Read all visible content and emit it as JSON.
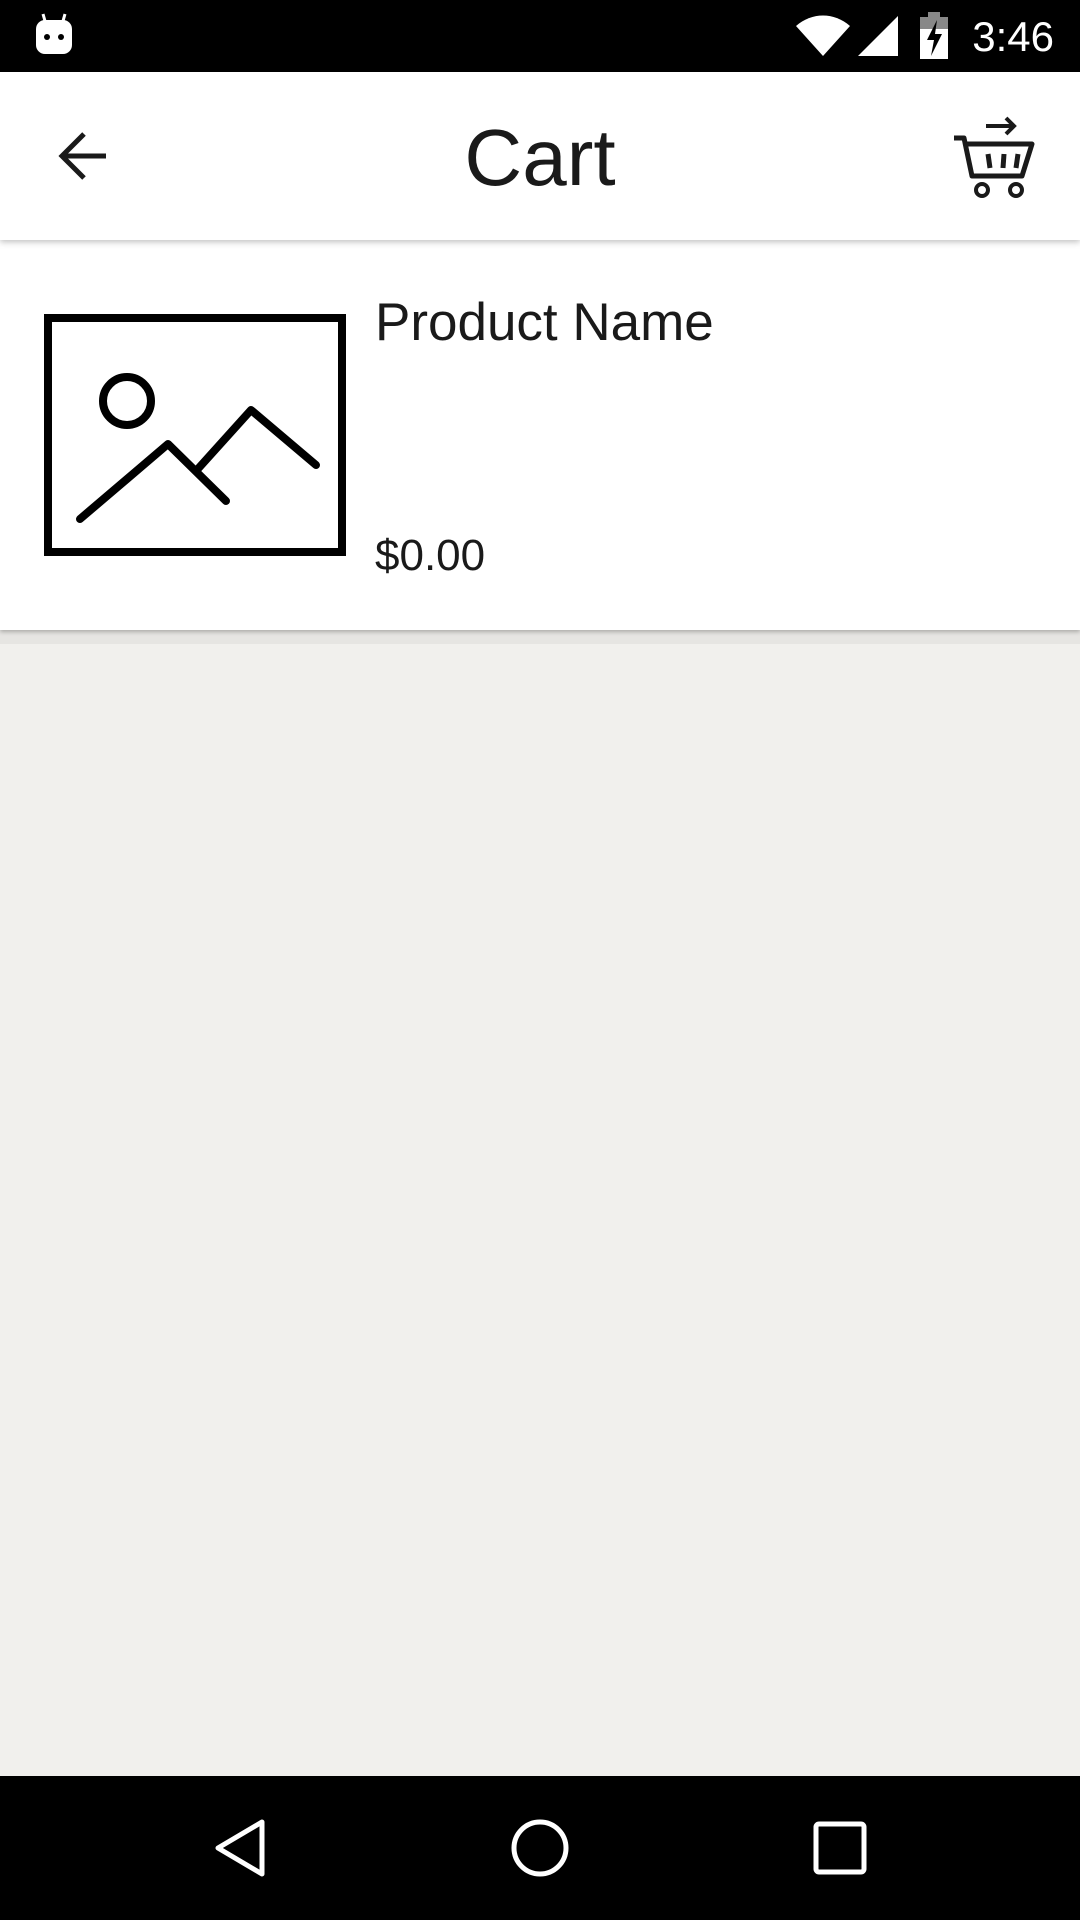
{
  "status_bar": {
    "time": "3:46",
    "icons": [
      "debug-icon",
      "wifi-icon",
      "signal-icon",
      "battery-charging-icon"
    ]
  },
  "app_bar": {
    "title": "Cart",
    "back_icon": "arrow-left-icon",
    "cart_icon": "cart-arrow-icon"
  },
  "cart": {
    "items": [
      {
        "name": "Product Name",
        "price": "$0.00",
        "image_icon": "image-placeholder-icon"
      }
    ]
  },
  "nav_bar": {
    "icons": [
      "nav-back-icon",
      "nav-home-icon",
      "nav-recents-icon"
    ]
  },
  "colors": {
    "background": "#f1f0ed",
    "surface": "#ffffff",
    "text": "#1a1a1a",
    "system_bars": "#000000"
  }
}
